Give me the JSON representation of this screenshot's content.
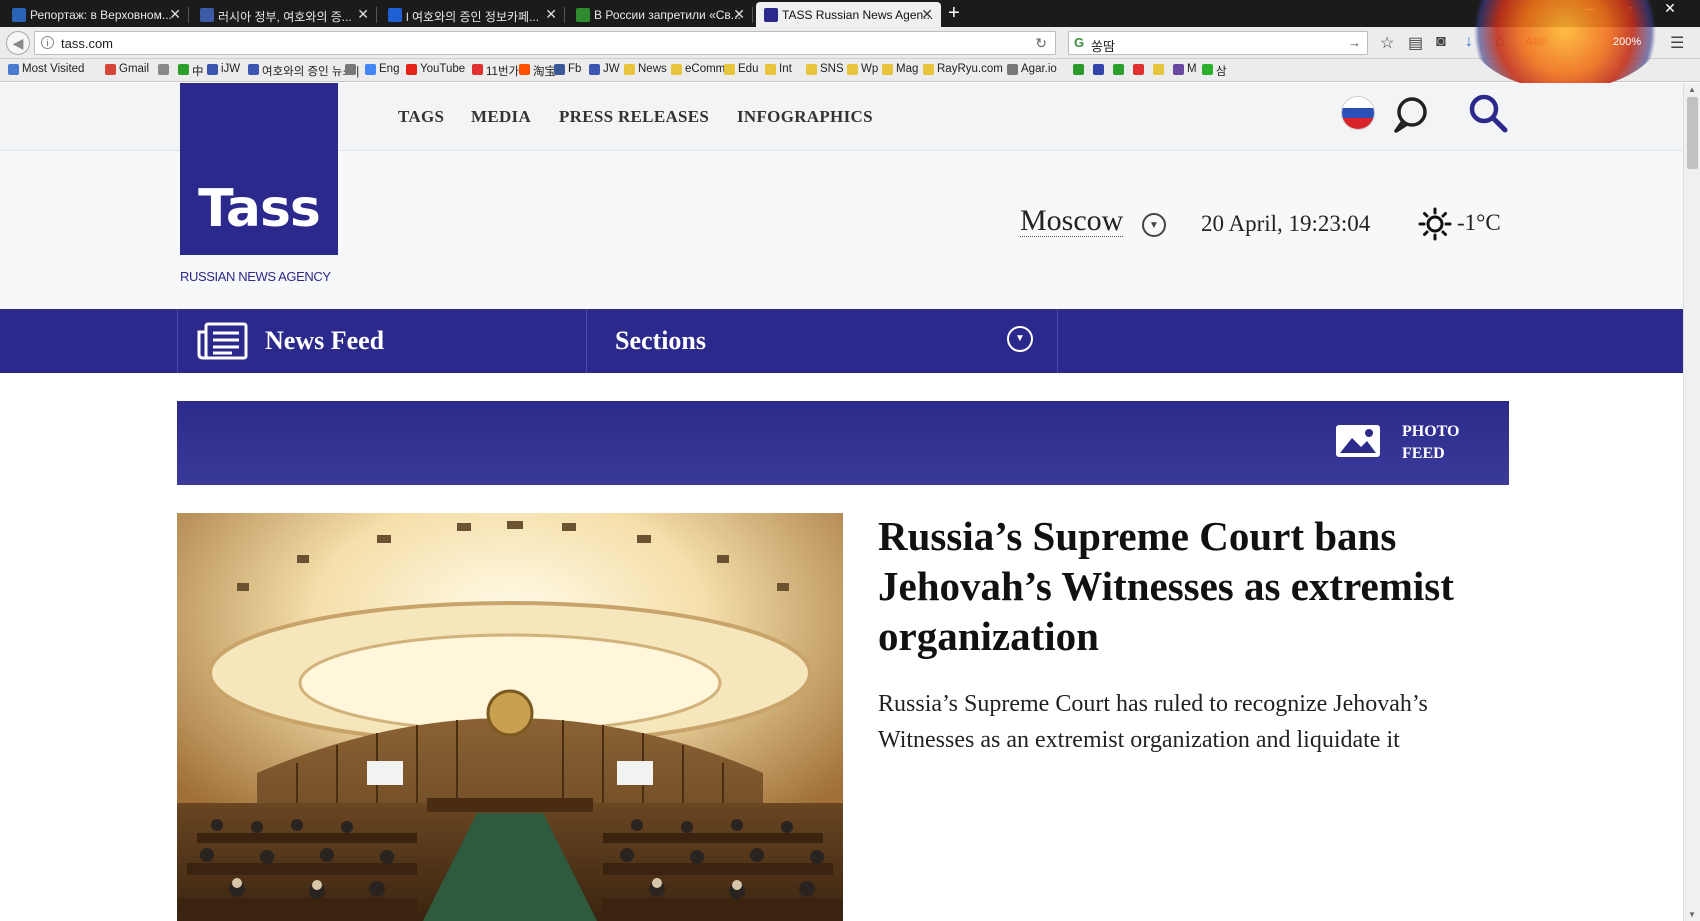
{
  "browser": {
    "tabs": [
      {
        "title": "Репортаж: в Верховном...",
        "favicon_color": "#2b63b8",
        "active": false
      },
      {
        "title": "러시아 정부, 여호와의 증...",
        "favicon_color": "#3b5ba8",
        "active": false
      },
      {
        "title": "l 여호와의 증인 정보카페...",
        "favicon_color": "#1f5fd6",
        "active": false
      },
      {
        "title": "В России запретили «Св...",
        "favicon_color": "#2e8b2e",
        "active": false
      },
      {
        "title": "TASS Russian News Agen...",
        "favicon_color": "#2b2a8c",
        "active": true
      }
    ],
    "url": "tass.com",
    "search_text": "쏭땀",
    "zoom": "200%",
    "bookmarks": [
      {
        "label": "Most Visited",
        "color": "#4a7bd0"
      },
      {
        "label": "Gmail",
        "color": "#d44638"
      },
      {
        "label": "",
        "color": "#888888"
      },
      {
        "label": "中",
        "color": "#2aa02a"
      },
      {
        "label": "iJW",
        "color": "#3a56b0"
      },
      {
        "label": "여호와의 증인 뉴스 |",
        "color": "#3a56b0"
      },
      {
        "label": "",
        "color": "#777777"
      },
      {
        "label": "Eng",
        "color": "#4285f4"
      },
      {
        "label": "YouTube",
        "color": "#e62117"
      },
      {
        "label": "11번가",
        "color": "#e03030"
      },
      {
        "label": "淘宝",
        "color": "#ff5000"
      },
      {
        "label": "Fb",
        "color": "#3b5998"
      },
      {
        "label": "JW",
        "color": "#3a56b0"
      },
      {
        "label": "News",
        "color": "#e8c43a"
      },
      {
        "label": "eComm",
        "color": "#e8c43a"
      },
      {
        "label": "Edu",
        "color": "#e8c43a"
      },
      {
        "label": "Int",
        "color": "#e8c43a"
      },
      {
        "label": "SNS",
        "color": "#e8c43a"
      },
      {
        "label": "Wp",
        "color": "#e8c43a"
      },
      {
        "label": "Mag",
        "color": "#e8c43a"
      },
      {
        "label": "RayRyu.com",
        "color": "#e8c43a"
      },
      {
        "label": "Agar.io",
        "color": "#777777"
      },
      {
        "label": "",
        "color": "#2a9a2a"
      },
      {
        "label": "",
        "color": "#3344aa"
      },
      {
        "label": "",
        "color": "#2aa02a"
      },
      {
        "label": "",
        "color": "#e03030"
      },
      {
        "label": "",
        "color": "#e8c43a"
      },
      {
        "label": "M",
        "color": "#6a4aa0"
      },
      {
        "label": "삼",
        "color": "#2ab02a"
      }
    ]
  },
  "site": {
    "nav": [
      "TAGS",
      "MEDIA",
      "PRESS RELEASES",
      "INFOGRAPHICS"
    ],
    "logo": "Tass",
    "logo_caption": "RUSSIAN NEWS AGENCY",
    "city": "Moscow",
    "datetime": "20 April, 19:23:04",
    "temperature": "-1°C",
    "brand_color": "#2b2a8c",
    "news_feed_label": "News Feed",
    "sections_label": "Sections",
    "photo_feed_label_line1": "PHOTO",
    "photo_feed_label_line2": "FEED"
  },
  "article": {
    "headline": "Russia’s Supreme Court bans Jehovah’s Witnesses as extremist organization",
    "summary": "Russia’s Supreme Court has ruled to recognize Jehovah’s Witnesses as an extremist organization and liquidate it",
    "image_subject": "supreme-court-hall-photo"
  }
}
